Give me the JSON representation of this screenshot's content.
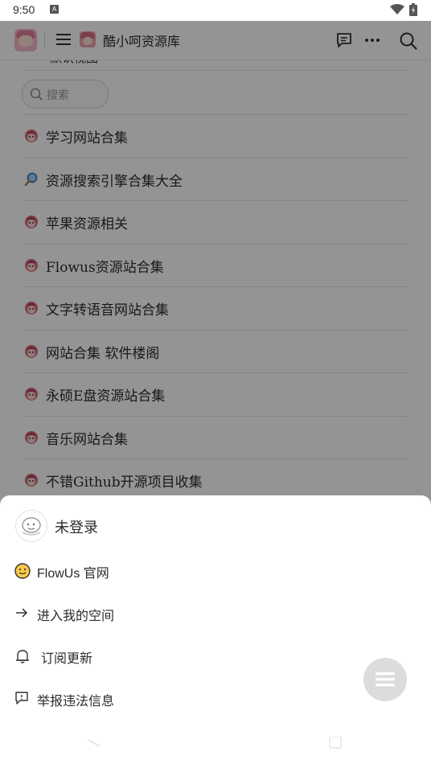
{
  "status_bar": {
    "time": "9:50",
    "badge": "A"
  },
  "app_bar": {
    "title": "酷小呵资源库"
  },
  "page": {
    "cut_off_row": "默认视图",
    "search": {
      "placeholder": "搜索"
    },
    "items": [
      {
        "icon": "pink-creature-icon",
        "label": "学习网站合集"
      },
      {
        "icon": "magnifier-icon",
        "label": "资源搜索引擎合集大全"
      },
      {
        "icon": "pink-creature-icon",
        "label": "苹果资源相关"
      },
      {
        "icon": "pink-creature-icon",
        "label": "Flowus资源站合集"
      },
      {
        "icon": "pink-creature-icon",
        "label": "文字转语音网站合集"
      },
      {
        "icon": "pink-creature-icon",
        "label": "网站合集 软件楼阁"
      },
      {
        "icon": "pink-creature-icon",
        "label": "永硕E盘资源站合集"
      },
      {
        "icon": "pink-creature-icon",
        "label": "音乐网站合集"
      },
      {
        "icon": "pink-creature-icon",
        "label": "不错Github开源项目收集"
      }
    ]
  },
  "sheet": {
    "user_label": "未登录",
    "items": [
      {
        "icon": "smiley-icon",
        "label": "FlowUs 官网"
      },
      {
        "icon": "arrow-right-icon",
        "label": "进入我的空间"
      },
      {
        "icon": "bell-icon",
        "label": "订阅更新"
      },
      {
        "icon": "report-icon",
        "label": "举报违法信息"
      }
    ]
  },
  "colors": {
    "overlay": "#00000066",
    "sheet_bg": "#ffffff",
    "fab": "#dcdcdc"
  }
}
